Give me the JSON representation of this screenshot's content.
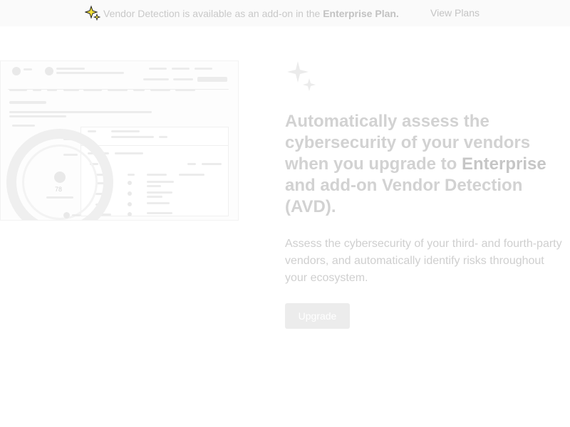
{
  "banner": {
    "message_prefix": "Vendor Detection is available as an add-on in the",
    "message_bold": "Enterprise Plan.",
    "link_label": "View Plans",
    "icon": "sparkle-icon"
  },
  "preview": {
    "score": "78"
  },
  "main": {
    "icon": "sparkles-icon",
    "headline_part1": "Automatically assess the cybersecurity of your vendors when you upgrade to",
    "headline_bold": "Enterprise",
    "headline_part2": "and add-on Vendor Detection (AVD).",
    "description": "Assess the cybersecurity of your third- and fourth-party vendors, and automatically identify risks throughout your ecosystem.",
    "button_label": "Upgrade"
  },
  "colors": {
    "banner_bg": "#fafafa",
    "button_bg": "#ececec",
    "sparkle_yellow": "#f5e33a"
  }
}
